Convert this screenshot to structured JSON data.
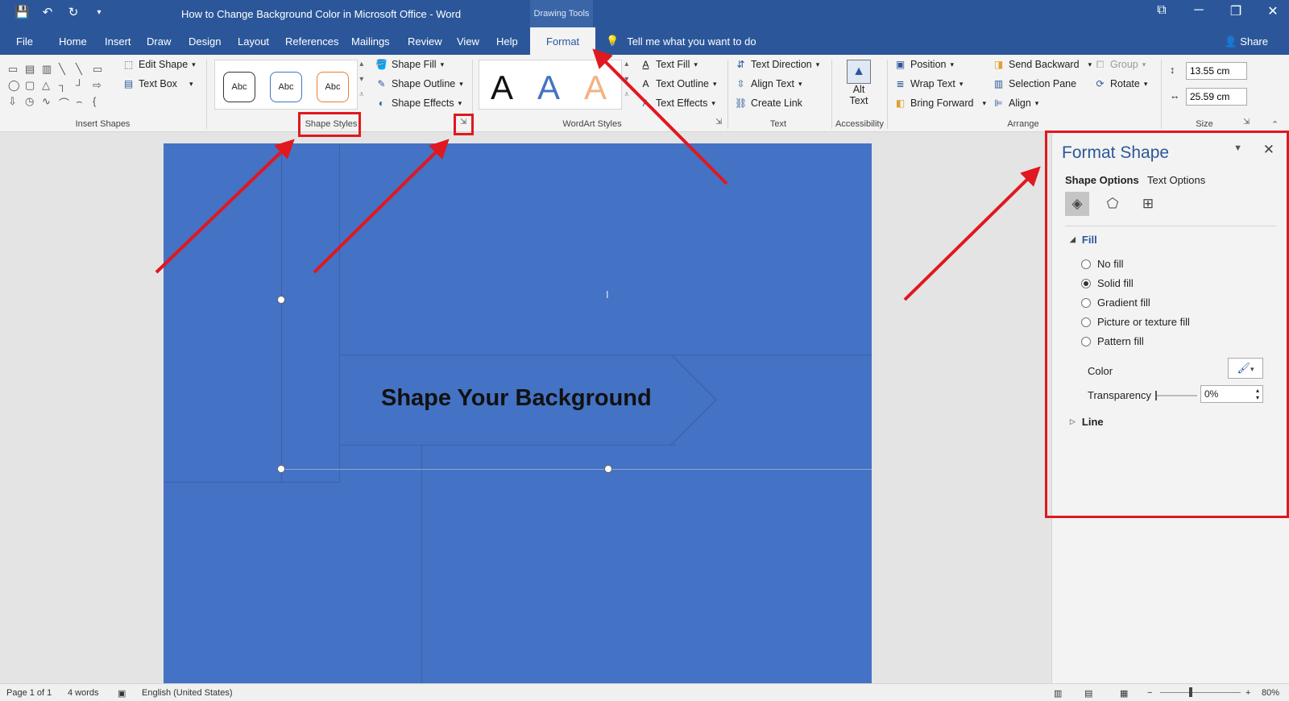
{
  "colors": {
    "accent": "#2b579a",
    "page_fill": "#4472c4",
    "annotation": "#e0181f"
  },
  "titlebar": {
    "qat_icons": [
      "save-icon",
      "undo-icon",
      "redo-icon",
      "customize-icon"
    ],
    "save_glyph": "💾",
    "undo_glyph": "↶",
    "redo_glyph": "↻",
    "customize_glyph": "▾",
    "doc_title": "How to Change Background Color in Microsoft Office  -  Word",
    "contextual_tab": "Drawing Tools",
    "ribbon_display_glyph": "⧉",
    "minimize_glyph": "─",
    "restore_glyph": "❐",
    "close_glyph": "✕"
  },
  "tabs": {
    "file": "File",
    "home": "Home",
    "insert": "Insert",
    "draw": "Draw",
    "design": "Design",
    "layout": "Layout",
    "references": "References",
    "mailings": "Mailings",
    "review": "Review",
    "view": "View",
    "help": "Help",
    "format": "Format",
    "tellme_glyph": "💡",
    "tellme": "Tell me what you want to do",
    "share": "Share",
    "share_glyph": "👤"
  },
  "ribbon": {
    "insert_shapes": {
      "label": "Insert Shapes",
      "edit_shape": "Edit Shape",
      "text_box": "Text Box",
      "shape_glyphs": [
        "▭",
        "▤",
        "▥",
        "╲",
        "╲",
        "▭",
        "◯",
        "▢",
        "△",
        "┐",
        "┘",
        "⇨",
        "⇩",
        "◷",
        "∿",
        "⌒",
        "⌢",
        "{"
      ]
    },
    "shape_styles": {
      "label": "Shape Styles",
      "presets": [
        "Abc",
        "Abc",
        "Abc"
      ],
      "shape_fill": "Shape Fill",
      "shape_outline": "Shape Outline",
      "shape_effects": "Shape Effects",
      "launcher_glyph": "⇲"
    },
    "wordart": {
      "label": "WordArt Styles",
      "letter": "A",
      "text_fill": "Text Fill",
      "text_outline": "Text Outline",
      "text_effects": "Text Effects"
    },
    "text": {
      "label": "Text",
      "text_direction": "Text Direction",
      "align_text": "Align Text",
      "create_link": "Create Link"
    },
    "accessibility": {
      "label": "Accessibility",
      "alt_text_1": "Alt",
      "alt_text_2": "Text"
    },
    "arrange": {
      "label": "Arrange",
      "position": "Position",
      "wrap_text": "Wrap Text",
      "bring_forward": "Bring Forward",
      "send_backward": "Send Backward",
      "selection_pane": "Selection Pane",
      "align": "Align",
      "group": "Group",
      "rotate": "Rotate"
    },
    "size": {
      "label": "Size",
      "height": "13.55 cm",
      "width": "25.59 cm"
    }
  },
  "document": {
    "headline": "Shape Your Background",
    "cursor": "I"
  },
  "format_shape": {
    "title": "Format Shape",
    "tab_shape": "Shape Options",
    "tab_text": "Text Options",
    "fill_section": "Fill",
    "fill_options": [
      {
        "label": "No fill",
        "selected": false
      },
      {
        "label": "Solid fill",
        "selected": true
      },
      {
        "label": "Gradient fill",
        "selected": false
      },
      {
        "label": "Picture or texture fill",
        "selected": false
      },
      {
        "label": "Pattern fill",
        "selected": false
      }
    ],
    "color_label": "Color",
    "transparency_label": "Transparency",
    "transparency_value": "0%",
    "line_section": "Line"
  },
  "statusbar": {
    "page": "Page 1 of 1",
    "words": "4 words",
    "language": "English (United States)",
    "zoom": "80%"
  }
}
